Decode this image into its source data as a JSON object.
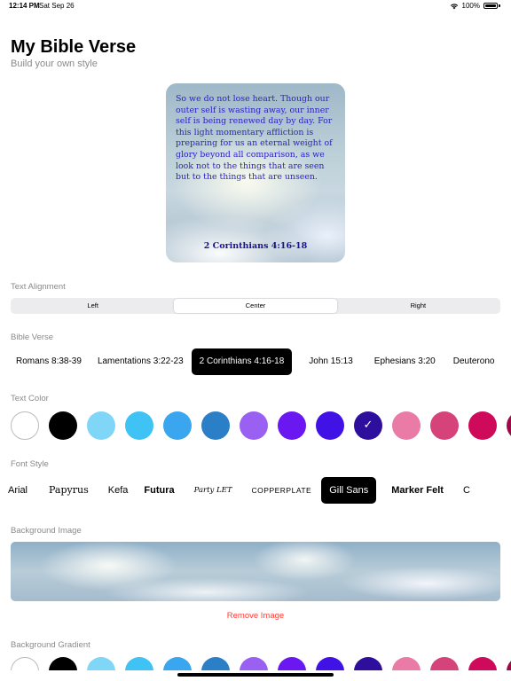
{
  "status_bar": {
    "time": "12:14 PM",
    "date": "Sat Sep 26",
    "battery": "100%"
  },
  "header": {
    "title": "My Bible Verse",
    "subtitle": "Build your own style"
  },
  "preview": {
    "verse": "So we do not lose heart. Though our outer self is wasting away, our inner self is being renewed day by day. For this light momentary affliction is preparing for us an eternal weight of glory beyond all comparison, as we look not to the things that are seen but to the things that are unseen.",
    "reference": "2 Corinthians 4:16-18"
  },
  "text_alignment": {
    "label": "Text Alignment",
    "options": [
      "Left",
      "Center",
      "Right"
    ],
    "selected": "Center"
  },
  "bible_verse": {
    "label": "Bible Verse",
    "items": [
      "Romans 8:38-39",
      "Lamentations 3:22-23",
      "2 Corinthians 4:16-18",
      "John 15:13",
      "Ephesians 3:20",
      "Deuterono"
    ],
    "selected": "2 Corinthians 4:16-18"
  },
  "text_color": {
    "label": "Text Color",
    "colors": [
      "#ffffff",
      "#000000",
      "#7fd6f7",
      "#3fc2f4",
      "#3aa6ef",
      "#2b7fc6",
      "#9a60f2",
      "#6a17f2",
      "#4012e6",
      "#2e0f9d",
      "#e97ba6",
      "#d6437a",
      "#cf0a5a",
      "#9e0a48"
    ],
    "selected_index": 9
  },
  "font_style": {
    "label": "Font Style",
    "items": [
      "Arial",
      "Papyrus",
      "Kefa",
      "Futura",
      "Party LET",
      "COPPERPLATE",
      "Gill Sans",
      "Marker Felt",
      "C"
    ],
    "selected": "Gill Sans"
  },
  "background_image": {
    "label": "Background Image",
    "remove_label": "Remove Image"
  },
  "background_gradient": {
    "label": "Background Gradient"
  }
}
